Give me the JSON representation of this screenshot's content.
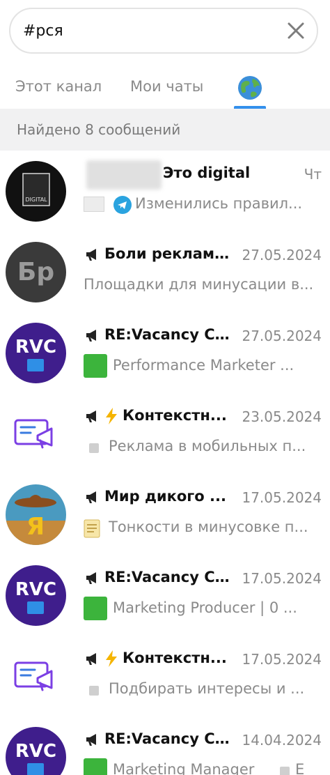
{
  "search": {
    "value": "#рся"
  },
  "tabs": [
    {
      "label": "Этот канал"
    },
    {
      "label": "Мои чаты"
    },
    {
      "icon": "globe-icon"
    }
  ],
  "found_text": "Найдено 8 сообщений",
  "accent": "#3390ec",
  "results": [
    {
      "title": "Это digital",
      "date": "Чт",
      "message": "Изменились правил..."
    },
    {
      "title": "Боли реклам...",
      "date": "27.05.2024",
      "message": "Площадки для минусации в...",
      "avatar_text": "Бр"
    },
    {
      "title": "RE:Vacancy C...",
      "date": "27.05.2024",
      "message": "Performance Marketer ...",
      "avatar_text": "RVC"
    },
    {
      "title": "Контекстн...",
      "date": "23.05.2024",
      "message": "Реклама в мобильных п..."
    },
    {
      "title": "Мир дикого ...",
      "date": "17.05.2024",
      "message": "Тонкости в минусовке п..."
    },
    {
      "title": "RE:Vacancy C...",
      "date": "17.05.2024",
      "message": "Marketing Producer | 0 ...",
      "avatar_text": "RVC"
    },
    {
      "title": "Контекстн...",
      "date": "17.05.2024",
      "message": "Подбирать интересы и ..."
    },
    {
      "title": "RE:Vacancy C...",
      "date": "14.04.2024",
      "message": "Marketing Manager",
      "message_tail": "E",
      "avatar_text": "RVC"
    }
  ]
}
